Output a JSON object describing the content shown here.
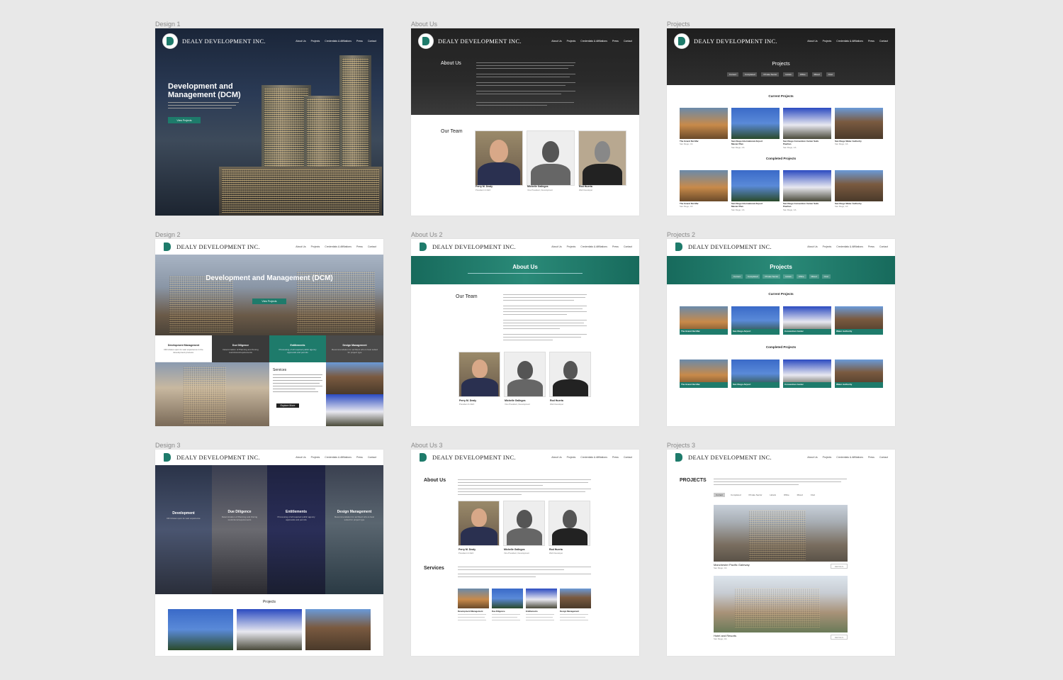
{
  "artboards": {
    "design1": {
      "label": "Design 1",
      "brand": "DEALY DEVELOPMENT INC.",
      "nav": [
        "About Us",
        "Projects",
        "Credentials & Affiliations",
        "Press",
        "Contact"
      ],
      "hero_title": "Development and Management (DCM)",
      "cta": "View Projects"
    },
    "about1": {
      "label": "About Us",
      "brand": "DEALY DEVELOPMENT INC.",
      "nav": [
        "About Us",
        "Projects",
        "Credentials & Affiliations",
        "Press",
        "Contact"
      ],
      "about_title": "About Us",
      "team_title": "Our Team",
      "team": [
        {
          "name": "Perry M. Dealy",
          "role": "President & CEO"
        },
        {
          "name": "Michelle Gallegos",
          "role": "Vice President, Development"
        },
        {
          "name": "Rod Huerta",
          "role": "Web Developer"
        }
      ]
    },
    "projects1": {
      "label": "Projects",
      "brand": "DEALY DEVELOPMENT INC.",
      "nav": [
        "About Us",
        "Projects",
        "Credentials & Affiliations",
        "Press",
        "Contact"
      ],
      "title": "Projects",
      "filters": [
        "Current",
        "Completed",
        "Private Sector",
        "Hotels",
        "Office",
        "Mixed",
        "Civic"
      ],
      "current_title": "Current Projects",
      "completed_title": "Completed Projects",
      "items": [
        {
          "name": "The Grand Del Mar",
          "loc": "San Diego, CA"
        },
        {
          "name": "San Diego International Airport Master Plan",
          "loc": "San Diego, CA"
        },
        {
          "name": "San Diego Convention Center Sails Pavilion",
          "loc": "San Diego, CA"
        },
        {
          "name": "San Diego Water Authority",
          "loc": "San Diego, CA"
        }
      ]
    },
    "design2": {
      "label": "Design 2",
      "brand": "DEALY DEVELOPMENT INC.",
      "nav": [
        "About Us",
        "Projects",
        "Credentials & Affiliations",
        "Press",
        "Contact"
      ],
      "hero_title": "Development and Management (DCM)",
      "cta": "View Projects",
      "services": [
        {
          "title": "Development Management",
          "text": "DDI draws upon its vast experience in the development process."
        },
        {
          "title": "Due Diligence",
          "text": "Determination of Planning and Zoning restrictions/requirements"
        },
        {
          "title": "Entitlements",
          "text": "Processing of all required public agency approvals and permits"
        },
        {
          "title": "Design Management",
          "text": "Recommendation for architect who is best suited for project type"
        }
      ],
      "services_title": "Services",
      "explore": "Explore More"
    },
    "about2": {
      "label": "About Us 2",
      "brand": "DEALY DEVELOPMENT INC.",
      "nav": [
        "About Us",
        "Projects",
        "Credentials & Affiliations",
        "Press",
        "Contact"
      ],
      "about_title": "About Us",
      "team_title": "Our Team",
      "team": [
        {
          "name": "Perry M. Dealy",
          "role": "President & CEO"
        },
        {
          "name": "Michelle Gallegos",
          "role": "Vice President, Development"
        },
        {
          "name": "Rod Huerta",
          "role": "Web Developer"
        }
      ]
    },
    "projects2": {
      "label": "Projects 2",
      "brand": "DEALY DEVELOPMENT INC.",
      "nav": [
        "About Us",
        "Projects",
        "Credentials & Affiliations",
        "Press",
        "Contact"
      ],
      "title": "Projects",
      "filters": [
        "Current",
        "Completed",
        "Private Sector",
        "Hotels",
        "Office",
        "Mixed",
        "Civic"
      ],
      "current_title": "Current Projects",
      "completed_title": "Completed Projects",
      "items": [
        {
          "name": "The Grand Del Mar",
          "loc": "San Diego, CA"
        },
        {
          "name": "San Diego Airport",
          "loc": "San Diego, CA"
        },
        {
          "name": "Convention Center",
          "loc": "San Diego, CA"
        },
        {
          "name": "Water Authority",
          "loc": "San Diego, CA"
        }
      ]
    },
    "design3": {
      "label": "Design 3",
      "brand": "DEALY DEVELOPMENT INC.",
      "nav": [
        "About Us",
        "Projects",
        "Credentials & Affiliations",
        "Press",
        "Contact"
      ],
      "columns": [
        {
          "title": "Development",
          "text": "DDI draws upon its vast experience"
        },
        {
          "title": "Due Diligence",
          "text": "Determination of Planning and Zoning restrictions/requirements"
        },
        {
          "title": "Entitlements",
          "text": "Processing of all required public agency approvals and permits"
        },
        {
          "title": "Design Management",
          "text": "Recommendation for architect who is best suited for project type"
        }
      ],
      "projects_title": "Projects"
    },
    "about3": {
      "label": "About Us 3",
      "brand": "DEALY DEVELOPMENT INC.",
      "nav": [
        "About Us",
        "Projects",
        "Credentials & Affiliations",
        "Press",
        "Contact"
      ],
      "about_title": "About Us",
      "services_title": "Services",
      "team": [
        {
          "name": "Perry M. Dealy",
          "role": "President & CEO"
        },
        {
          "name": "Michelle Gallegos",
          "role": "Vice President, Development"
        },
        {
          "name": "Rod Huerta",
          "role": "Web Developer"
        }
      ],
      "services": [
        {
          "title": "Development Management"
        },
        {
          "title": "Due Diligence"
        },
        {
          "title": "Entitlements"
        },
        {
          "title": "Design Management"
        }
      ]
    },
    "projects3": {
      "label": "Projects 3",
      "brand": "DEALY DEVELOPMENT INC.",
      "nav": [
        "About Us",
        "Projects",
        "Credentials & Affiliations",
        "Press",
        "Contact"
      ],
      "title": "PROJECTS",
      "filters": [
        "Current",
        "Completed",
        "Private Sector",
        "Hotels",
        "Office",
        "Mixed",
        "Civic"
      ],
      "items": [
        {
          "name": "Manchester Pacific Gateway",
          "loc": "San Diego, CA",
          "btn": "DETAILS"
        },
        {
          "name": "Hotel and Resorts",
          "loc": "San Diego, CA",
          "btn": "DETAILS"
        }
      ]
    }
  },
  "colors": {
    "teal": "#1e7b6b",
    "canvas": "#e8e8e8"
  }
}
